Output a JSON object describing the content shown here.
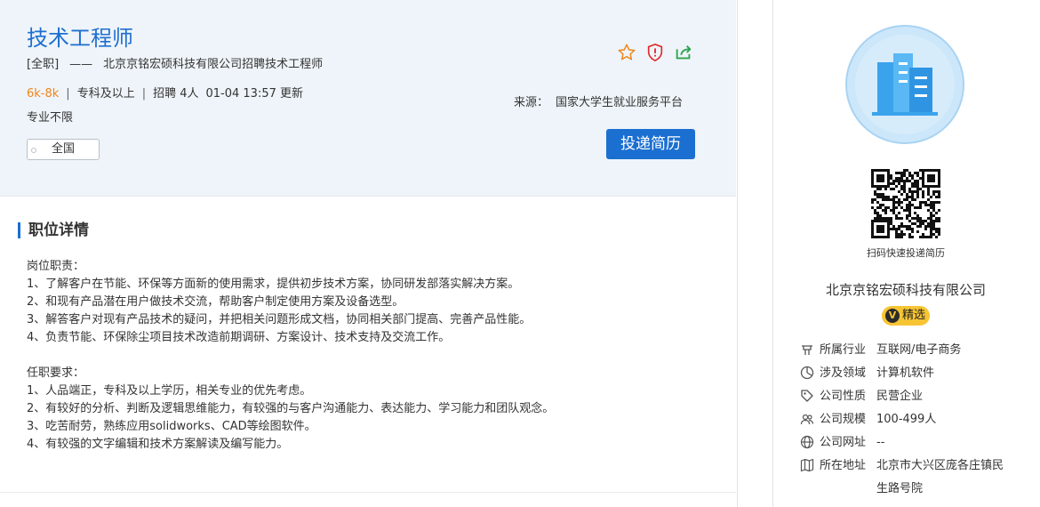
{
  "job": {
    "title": "技术工程师",
    "type": "[全职]",
    "dash": "——",
    "subtitle": "北京京铭宏硕科技有限公司招聘技术工程师",
    "salary": "6k-8k",
    "sep": "|",
    "education": "专科及以上",
    "headcount": "招聘 4人",
    "updated": "01-04 13:57 更新",
    "major": "专业不限",
    "region": "全国",
    "source_label": "来源：",
    "source_value": "国家大学生就业服务平台",
    "apply_label": "投递简历",
    "accent": "#1b6fd1",
    "salary_color": "#f08519"
  },
  "icons": [
    "star-icon",
    "shield-icon",
    "share-icon"
  ],
  "details": {
    "heading": "职位详情",
    "lines": [
      "岗位职责：",
      "1、了解客户在节能、环保等方面新的使用需求，提供初步技术方案，协同研发部落实解决方案。",
      "2、和现有产品潜在用户做技术交流，帮助客户制定使用方案及设备选型。",
      "3、解答客户对现有产品技术的疑问，并把相关问题形成文档，协同相关部门提高、完善产品性能。",
      "4、负责节能、环保除尘项目技术改造前期调研、方案设计、技术支持及交流工作。",
      "",
      "任职要求：",
      "1、人品端正，专科及以上学历，相关专业的优先考虑。",
      "2、有较好的分析、判断及逻辑思维能力，有较强的与客户沟通能力、表达能力、学习能力和团队观念。",
      "3、吃苦耐劳，熟练应用solidworks、CAD等绘图软件。",
      "4、有较强的文字编辑和技术方案解读及编写能力。"
    ]
  },
  "company": {
    "qr_caption": "扫码快速投递简历",
    "name": "北京京铭宏硕科技有限公司",
    "badge_v": "V",
    "badge": "精选",
    "info": [
      {
        "icon": "industry-icon",
        "key": "所属行业",
        "value": "互联网/电子商务"
      },
      {
        "icon": "domain-icon",
        "key": "涉及领域",
        "value": "计算机软件"
      },
      {
        "icon": "tag-icon",
        "key": "公司性质",
        "value": "民营企业"
      },
      {
        "icon": "people-icon",
        "key": "公司规模",
        "value": "100-499人"
      },
      {
        "icon": "globe-icon",
        "key": "公司网址",
        "value": "--"
      },
      {
        "icon": "map-icon",
        "key": "所在地址",
        "value": "北京市大兴区庞各庄镇民生路号院"
      }
    ]
  }
}
